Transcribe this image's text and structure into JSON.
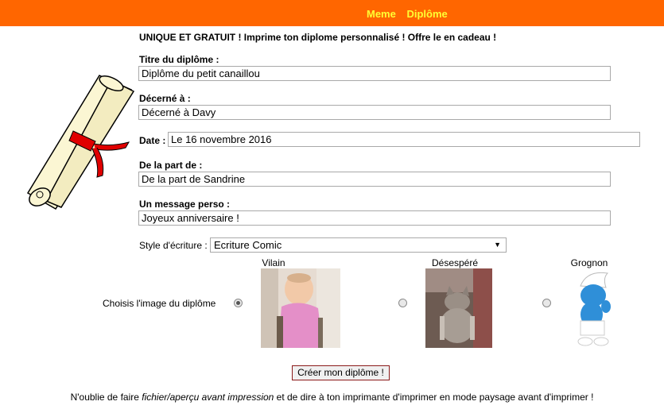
{
  "nav": {
    "items": [
      "Meme",
      "Diplôme"
    ]
  },
  "intro": "UNIQUE ET GRATUIT ! Imprime ton diplome personnalisé ! Offre le en cadeau !",
  "form": {
    "title_label": "Titre du diplôme :",
    "title_value": "Diplôme du petit canaillou",
    "awarded_label": "Décerné à :",
    "awarded_value": "Décerné à Davy",
    "date_label": "Date :",
    "date_value": "Le 16 novembre 2016",
    "from_label": "De la part de :",
    "from_value": "De la part de Sandrine",
    "message_label": "Un message perso :",
    "message_value": "Joyeux anniversaire !",
    "style_label": "Style d'écriture :",
    "style_value": "Ecriture Comic",
    "image_label": "Choisis l'image du diplôme",
    "images": [
      {
        "caption": "Vilain",
        "selected": true,
        "icon": "baby-photo"
      },
      {
        "caption": "Désespéré",
        "selected": false,
        "icon": "cat-photo"
      },
      {
        "caption": "Grognon",
        "selected": false,
        "icon": "smurf-figure"
      }
    ],
    "submit_label": "Créer mon diplôme !"
  },
  "footer": {
    "part1": "N'oublie de faire ",
    "italic": "fichier/aperçu avant impression",
    "part2": " et de dire à ton imprimante d'imprimer en mode paysage avant d'imprimer !"
  },
  "colors": {
    "topbar": "#ff6600",
    "nav_text": "#ffff33",
    "ribbon": "#e00000"
  }
}
